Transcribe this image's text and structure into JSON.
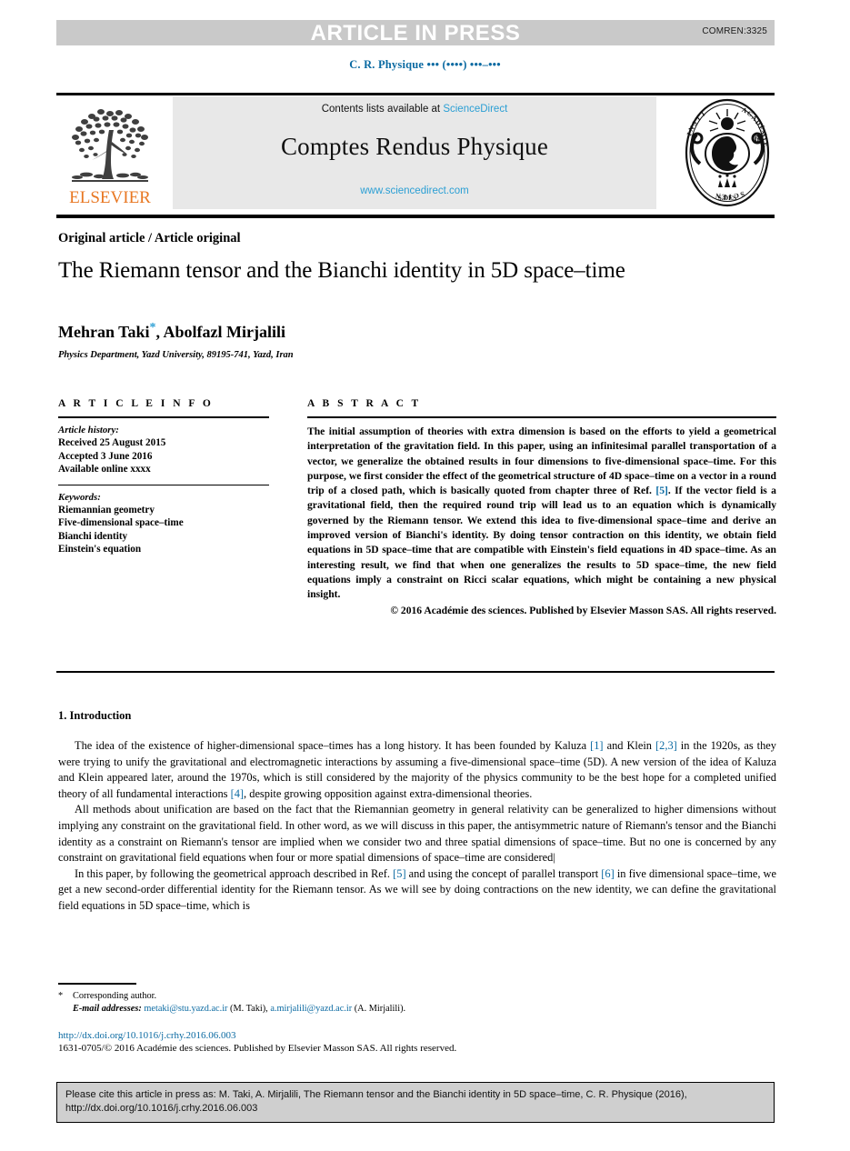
{
  "banner": {
    "label": "ARTICLE IN PRESS",
    "comren": "COMREN:3325"
  },
  "running_head": "C. R. Physique ••• (••••) •••–•••",
  "masthead": {
    "contents_prefix": "Contents lists available at ",
    "sciencedirect_link": "ScienceDirect",
    "journal_title": "Comptes Rendus Physique",
    "journal_url": "www.sciencedirect.com",
    "publisher_wordmark": "ELSEVIER"
  },
  "article": {
    "kicker": "Original article / Article original",
    "title": "The Riemann tensor and the Bianchi identity in 5D space–time",
    "authors": "Mehran Taki",
    "corresponding_marker": "*",
    "authors_rest": ", Abolfazl Mirjalili",
    "affiliation": "Physics Department, Yazd University, 89195-741, Yazd, Iran"
  },
  "info": {
    "heading": "A R T I C L E    I N F O",
    "history_label": "Article history:",
    "history": [
      "Received 25 August 2015",
      "Accepted 3 June 2016",
      "Available online xxxx"
    ],
    "keywords_label": "Keywords:",
    "keywords": [
      "Riemannian geometry",
      "Five-dimensional space–time",
      "Bianchi identity",
      "Einstein's equation"
    ]
  },
  "abstract": {
    "heading": "A B S T R A C T",
    "part1": "The initial assumption of theories with extra dimension is based on the efforts to yield a geometrical interpretation of the gravitation field. In this paper, using an infinitesimal parallel transportation of a vector, we generalize the obtained results in four dimensions to five-dimensional space–time. For this purpose, we first consider the effect of the geometrical structure of 4D space–time on a vector in a round trip of a closed path, which is basically quoted from chapter three of Ref. ",
    "ref1": "[5]",
    "part2": ". If the vector field is a gravitational field, then the required round trip will lead us to an equation which is dynamically governed by the Riemann tensor. We extend this idea to five-dimensional space–time and derive an improved version of Bianchi's identity. By doing tensor contraction on this identity, we obtain field equations in 5D space–time that are compatible with Einstein's field equations in 4D space–time. As an interesting result, we find that when one generalizes the results to 5D space–time, the new field equations imply a constraint on Ricci scalar equations, which might be containing a new physical insight.",
    "copyright": "© 2016 Académie des sciences. Published by Elsevier Masson SAS. All rights reserved."
  },
  "body": {
    "section_title": "1. Introduction",
    "p1_a": "The idea of the existence of higher-dimensional space–times has a long history. It has been founded by Kaluza ",
    "p1_r1": "[1]",
    "p1_b": " and Klein ",
    "p1_r2": "[2,3]",
    "p1_c": " in the 1920s, as they were trying to unify the gravitational and electromagnetic interactions by assuming a five-dimensional space–time (5D). A new version of the idea of Kaluza and Klein appeared later, around the 1970s, which is still considered by the majority of the physics community to be the best hope for a completed unified theory of all fundamental interactions ",
    "p1_r3": "[4]",
    "p1_d": ", despite growing opposition against extra-dimensional theories.",
    "p2": "All methods about unification are based on the fact that the Riemannian geometry in general relativity can be generalized to higher dimensions without implying any constraint on the gravitational field. In other word, as we will discuss in this paper, the antisymmetric nature of Riemann's tensor and the Bianchi identity as a constraint on Riemann's tensor are implied when we consider two and three spatial dimensions of space–time. But no one is concerned by any constraint on gravitational field equations when four or more spatial dimensions of space–time are considered|",
    "p3_a": "In this paper, by following the geometrical approach described in Ref. ",
    "p3_r1": "[5]",
    "p3_b": " and using the concept of parallel transport ",
    "p3_r2": "[6]",
    "p3_c": " in five dimensional space–time, we get a new second-order differential identity for the Riemann tensor. As we will see by doing contractions on the new identity, we can define the gravitational field equations in 5D space–time, which is"
  },
  "footnotes": {
    "star": "*",
    "corresponding": "Corresponding author.",
    "email_label": "E-mail addresses:",
    "email1": "metaki@stu.yazd.ac.ir",
    "email1_who": " (M. Taki), ",
    "email2": "a.mirjalili@yazd.ac.ir",
    "email2_who": " (A. Mirjalili).",
    "doi": "http://dx.doi.org/10.1016/j.crhy.2016.06.003",
    "issn": "1631-0705/© 2016 Académie des sciences. Published by Elsevier Masson SAS. All rights reserved."
  },
  "cite_box": {
    "line1": "Please cite this article in press as: M. Taki, A. Mirjalili, The Riemann tensor and the Bianchi identity in 5D space–time, C. R. Physique (2016),",
    "line2": "http://dx.doi.org/10.1016/j.crhy.2016.06.003"
  },
  "colors": {
    "link": "#0b6aa2",
    "sciencedirect": "#2b9fd4",
    "elsevier_orange": "#e87722",
    "banner_gray": "#c9c9c9",
    "masthead_gray": "#e8e8e8",
    "cite_gray": "#cfcfcf"
  }
}
